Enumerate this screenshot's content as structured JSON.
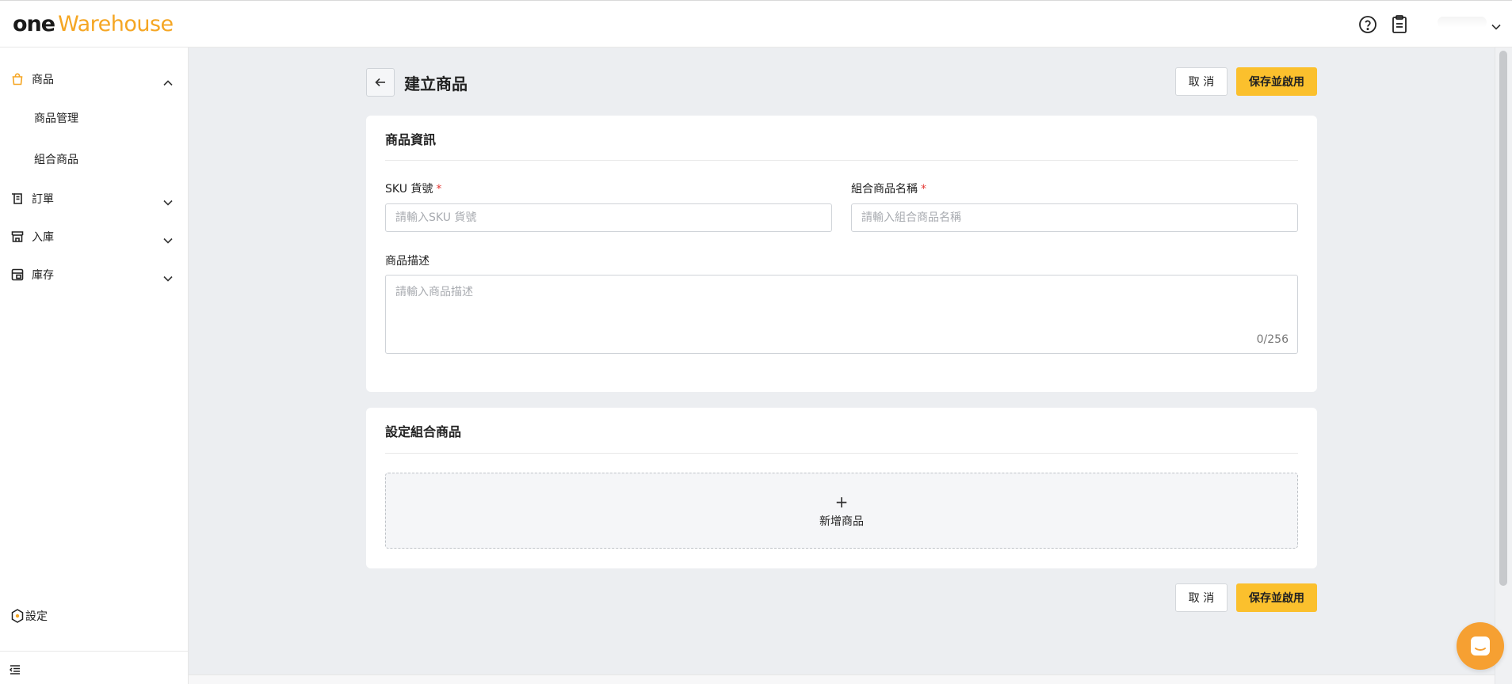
{
  "app": {
    "logo_one": "one",
    "logo_warehouse": "Warehouse"
  },
  "sidebar": {
    "groups": [
      {
        "label": "商品",
        "icon": "shopping-bag-icon",
        "expanded": true,
        "sub_items": [
          {
            "label": "商品管理"
          },
          {
            "label": "組合商品"
          }
        ]
      },
      {
        "label": "訂單",
        "icon": "order-list-icon",
        "expanded": false
      },
      {
        "label": "入庫",
        "icon": "inbound-store-icon",
        "expanded": false
      },
      {
        "label": "庫存",
        "icon": "inventory-icon",
        "expanded": false
      }
    ],
    "settings_label": "設定"
  },
  "header": {
    "title": "建立商品",
    "cancel_label": "取 消",
    "save_label": "保存並啟用"
  },
  "product_info": {
    "title": "商品資訊",
    "sku_label": "SKU 貨號",
    "sku_placeholder": "請輸入SKU 貨號",
    "sku_value": "",
    "name_label": "組合商品名稱",
    "name_placeholder": "請輸入組合商品名稱",
    "name_value": "",
    "required_mark": "*",
    "desc_label": "商品描述",
    "desc_placeholder": "請輸入商品描述",
    "desc_value": "",
    "desc_counter": "0/256"
  },
  "bundle": {
    "title": "設定組合商品",
    "add_plus": "+",
    "add_label": "新增商品"
  },
  "footer": {
    "cancel_label": "取 消",
    "save_label": "保存並啟用"
  },
  "colors": {
    "accent": "#fbc02d",
    "brand_orange": "#f5a623",
    "required": "#e53935",
    "chat": "#f6a032"
  }
}
